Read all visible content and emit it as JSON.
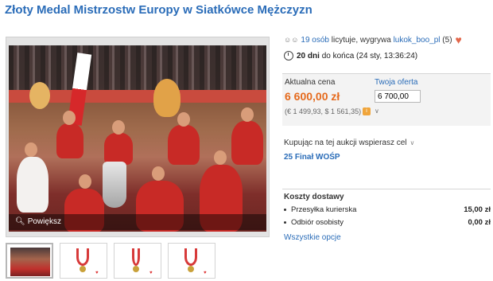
{
  "title": "Złoty Medal Mistrzostw Europy w Siatkówce Mężczyzn",
  "gallery": {
    "zoom_label": "Powiększ"
  },
  "bidding": {
    "bidders_count": "19 osób",
    "bidders_text": "licytuje, wygrywa",
    "leader": "lukok_boo_pl",
    "leader_rating": "(5)",
    "time_left": "20 dni",
    "time_text": "do końca (24 sty, 13:36:24)"
  },
  "price": {
    "current_label": "Aktualna cena",
    "current_value": "6 600,00 zł",
    "conversion": "(€ 1 499,93, $ 1 561,35)",
    "offer_label": "Twoja oferta",
    "offer_value": "6 700,00"
  },
  "charity": {
    "text": "Kupując na tej aukcji wspierasz cel",
    "cause": "25 Finał WOŚP"
  },
  "shipping": {
    "heading": "Koszty dostawy",
    "options": [
      {
        "name": "Przesyłka kurierska",
        "price": "15,00 zł"
      },
      {
        "name": "Odbiór osobisty",
        "price": "0,00 zł"
      }
    ],
    "all_options": "Wszystkie opcje"
  },
  "colors": {
    "link": "#2a6cb8",
    "price": "#e56a1d",
    "heart": "#e2674b"
  }
}
